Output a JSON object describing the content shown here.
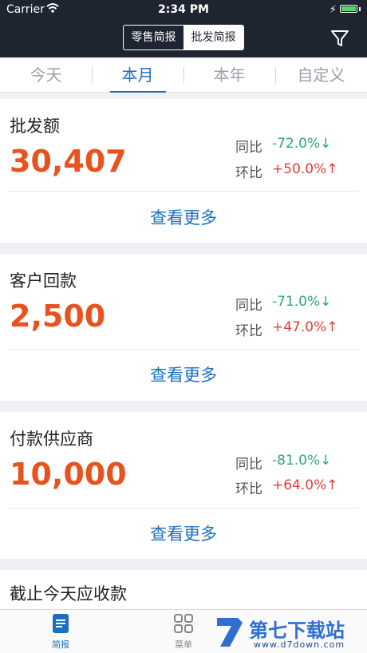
{
  "status_bar": {
    "carrier": "Carrier",
    "time": "2:34 PM"
  },
  "header": {
    "segments": [
      "零售简报",
      "批发简报"
    ],
    "active_segment": "批发简报"
  },
  "period_tabs": [
    "今天",
    "本月",
    "本年",
    "自定义"
  ],
  "active_period_tab": "本月",
  "colors": {
    "accent": "#1c6fc0",
    "value": "#e8521e",
    "down": "#2aa87a",
    "up": "#e23b3b",
    "header": "#1e2430"
  },
  "cards": [
    {
      "title": "批发额",
      "value": "30,407",
      "yoy_label": "同比",
      "yoy_value": "-72.0%↓",
      "mom_label": "环比",
      "mom_value": "+50.0%↑",
      "more": "查看更多"
    },
    {
      "title": "客户回款",
      "value": "2,500",
      "yoy_label": "同比",
      "yoy_value": "-71.0%↓",
      "mom_label": "环比",
      "mom_value": "+47.0%↑",
      "more": "查看更多"
    },
    {
      "title": "付款供应商",
      "value": "10,000",
      "yoy_label": "同比",
      "yoy_value": "-81.0%↓",
      "mom_label": "环比",
      "mom_value": "+64.0%↑",
      "more": "查看更多"
    },
    {
      "title": "截止今天应收款"
    }
  ],
  "tabbar": [
    {
      "label": "简报",
      "icon": "document-icon"
    },
    {
      "label": "菜单",
      "icon": "grid-icon"
    }
  ],
  "watermark": {
    "text": "第七下载站",
    "url": "www.d7down.com"
  }
}
